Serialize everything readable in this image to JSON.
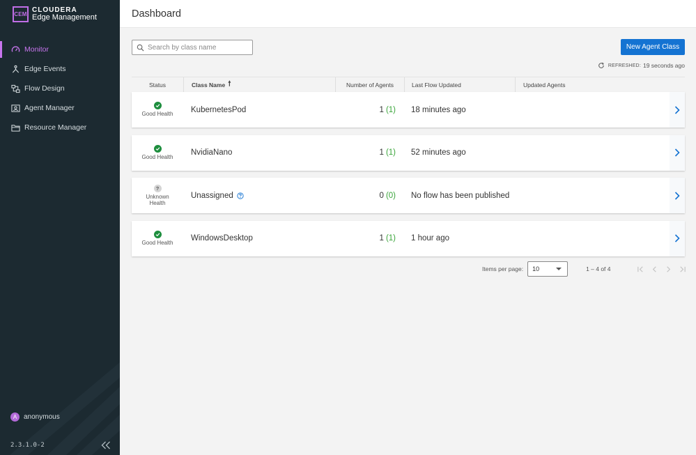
{
  "app": {
    "logo_text": "CEM",
    "brand": "CLOUDERA",
    "product": "Edge Management"
  },
  "sidebar": {
    "items": [
      {
        "label": "Monitor",
        "icon": "gauge-icon",
        "active": true
      },
      {
        "label": "Edge Events",
        "icon": "events-icon",
        "active": false
      },
      {
        "label": "Flow Design",
        "icon": "flow-icon",
        "active": false
      },
      {
        "label": "Agent Manager",
        "icon": "agent-icon",
        "active": false
      },
      {
        "label": "Resource Manager",
        "icon": "folder-icon",
        "active": false
      }
    ],
    "user": {
      "initial": "A",
      "name": "anonymous"
    },
    "version": "2.3.1.0-2",
    "collapse_icon": "double-chevron-left-icon"
  },
  "header": {
    "title": "Dashboard"
  },
  "toolbar": {
    "search_placeholder": "Search by class name",
    "search_value": "",
    "new_button_label": "New Agent Class",
    "refreshed_label": "REFRESHED:",
    "refreshed_value": "19 seconds ago"
  },
  "table": {
    "columns": {
      "status": "Status",
      "class_name": "Class Name",
      "num_agents": "Number of Agents",
      "last_flow": "Last Flow Updated",
      "updated_agents": "Updated Agents"
    },
    "rows": [
      {
        "status": "ok",
        "status_label": "Good Health",
        "name": "KubernetesPod",
        "agents": "1",
        "agents_ok": "(1)",
        "last_flow": "18 minutes ago",
        "updated": ""
      },
      {
        "status": "ok",
        "status_label": "Good Health",
        "name": "NvidiaNano",
        "agents": "1",
        "agents_ok": "(1)",
        "last_flow": "52 minutes ago",
        "updated": ""
      },
      {
        "status": "unknown",
        "status_label": "Unknown Health",
        "name": "Unassigned",
        "agents": "0",
        "agents_ok": "(0)",
        "last_flow": "No flow has been published",
        "updated": ""
      },
      {
        "status": "ok",
        "status_label": "Good Health",
        "name": "WindowsDesktop",
        "agents": "1",
        "agents_ok": "(1)",
        "last_flow": "1 hour ago",
        "updated": ""
      }
    ]
  },
  "pagination": {
    "items_per_page_label": "Items per page:",
    "items_per_page": "10",
    "range": "1 – 4 of 4"
  },
  "colors": {
    "sidebar_bg": "#1c2a31",
    "accent": "#c775ee",
    "primary_button": "#1473d2",
    "good": "#1e8e3e"
  }
}
